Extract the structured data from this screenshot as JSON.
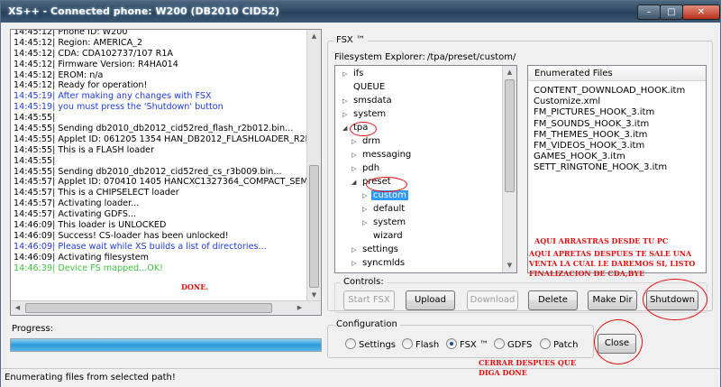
{
  "window": {
    "title": "XS++ - Connected phone: W200 (DB2010 CID52)"
  },
  "log": [
    {
      "text": "14:45:12| Phone ID: W200",
      "color": "normal"
    },
    {
      "text": "14:45:12| Region: AMERICA_2",
      "color": "normal"
    },
    {
      "text": "14:45:12| CDA: CDA102737/107   R1A",
      "color": "normal"
    },
    {
      "text": "14:45:12| Firmware Version: R4HA014",
      "color": "normal"
    },
    {
      "text": "14:45:12| EROM: n/a",
      "color": "normal"
    },
    {
      "text": "14:45:12| Ready for operation!",
      "color": "normal"
    },
    {
      "text": "14:45:19| After making any changes with FSX",
      "color": "blue"
    },
    {
      "text": "14:45:19| you must press the 'Shutdown' button",
      "color": "blue"
    },
    {
      "text": "14:45:55|",
      "color": "normal"
    },
    {
      "text": "14:45:55| Sending db2010_db2012_cid52red_flash_r2b012.bin...",
      "color": "normal"
    },
    {
      "text": "14:45:55| Applet ID: 061205 1354 HAN_DB2012_FLASHLOADER_R2E",
      "color": "normal"
    },
    {
      "text": "14:45:55| This is a FLASH loader",
      "color": "normal"
    },
    {
      "text": "14:45:55|",
      "color": "normal"
    },
    {
      "text": "14:45:55| Sending db2010_db2012_cid52red_cs_r3b009.bin...",
      "color": "normal"
    },
    {
      "text": "14:45:57| Applet ID: 070410 1405 HANCXC1327364_COMPACT_SEM",
      "color": "normal"
    },
    {
      "text": "14:45:57| This is a CHIPSELECT loader",
      "color": "normal"
    },
    {
      "text": "14:45:57| Activating loader...",
      "color": "normal"
    },
    {
      "text": "14:45:57| Activating GDFS...",
      "color": "normal"
    },
    {
      "text": "14:46:09| This loader is UNLOCKED",
      "color": "normal"
    },
    {
      "text": "14:46:09| Success! CS-loader has been unlocked!",
      "color": "normal"
    },
    {
      "text": "14:46:09| Please wait while XS builds a list of directories...",
      "color": "blue"
    },
    {
      "text": "14:46:09| Activating filesystem",
      "color": "normal"
    },
    {
      "text": "14:46:39| Device FS mapped...OK!",
      "color": "green"
    }
  ],
  "fsx": {
    "title": "FSX ™",
    "explorer_label": "Filesystem Explorer:",
    "path": "/tpa/preset/custom/",
    "tree": [
      {
        "label": "ifs",
        "level": 1,
        "expander": "collapsed"
      },
      {
        "label": "QUEUE",
        "level": 1,
        "expander": "none"
      },
      {
        "label": "smsdata",
        "level": 1,
        "expander": "collapsed"
      },
      {
        "label": "system",
        "level": 1,
        "expander": "collapsed"
      },
      {
        "label": "tpa",
        "level": 1,
        "expander": "expanded"
      },
      {
        "label": "drm",
        "level": 2,
        "expander": "collapsed"
      },
      {
        "label": "messaging",
        "level": 2,
        "expander": "collapsed"
      },
      {
        "label": "pdh",
        "level": 2,
        "expander": "collapsed"
      },
      {
        "label": "preset",
        "level": 2,
        "expander": "expanded"
      },
      {
        "label": "custom",
        "level": 3,
        "expander": "collapsed",
        "selected": true
      },
      {
        "label": "default",
        "level": 3,
        "expander": "collapsed"
      },
      {
        "label": "system",
        "level": 3,
        "expander": "collapsed"
      },
      {
        "label": "wizard",
        "level": 3,
        "expander": "none"
      },
      {
        "label": "settings",
        "level": 2,
        "expander": "collapsed"
      },
      {
        "label": "syncmlds",
        "level": 2,
        "expander": "collapsed"
      }
    ],
    "files_header": "Enumerated Files",
    "files": [
      "CONTENT_DOWNLOAD_HOOK.itm",
      "Customize.xml",
      "FM_PICTURES_HOOK_3.itm",
      "FM_SOUNDS_HOOK_3.itm",
      "FM_THEMES_HOOK_3.itm",
      "FM_VIDEOS_HOOK_3.itm",
      "GAMES_HOOK_3.itm",
      "SETT_RINGTONE_HOOK_3.itm"
    ]
  },
  "controls": {
    "title": "Controls:",
    "start_fsx": "Start FSX",
    "upload": "Upload",
    "download": "Download",
    "delete": "Delete",
    "make_dir": "Make Dir",
    "shutdown": "Shutdown"
  },
  "configuration": {
    "title": "Configuration",
    "options": [
      "Settings",
      "Flash",
      "FSX ™",
      "GDFS",
      "Patch"
    ],
    "selected": "FSX ™",
    "close": "Close"
  },
  "progress": {
    "label": "Progress:",
    "value": 1.0
  },
  "status": {
    "text": "Enumerating files from selected path!"
  },
  "annotations": {
    "done": "DONE.",
    "drag_note_1": "AQUI ARRASTRAS DESDE TU PC",
    "drag_note_2": "AQUI APRETAS DESPUES TE SALE UNA",
    "drag_note_3": "VENTA LA CUAL LE DAREMOS SI, LISTO",
    "drag_note_4": "FINALIZACION DE CDA,BYE",
    "close_note_1": "CERRAR DESPUES QUE",
    "close_note_2": "DIGA DONE"
  },
  "colors": {
    "log_blue": "#1f3cd8",
    "log_green": "#3ec23e",
    "annotation_red": "#e21010",
    "selection": "#3399ff"
  }
}
